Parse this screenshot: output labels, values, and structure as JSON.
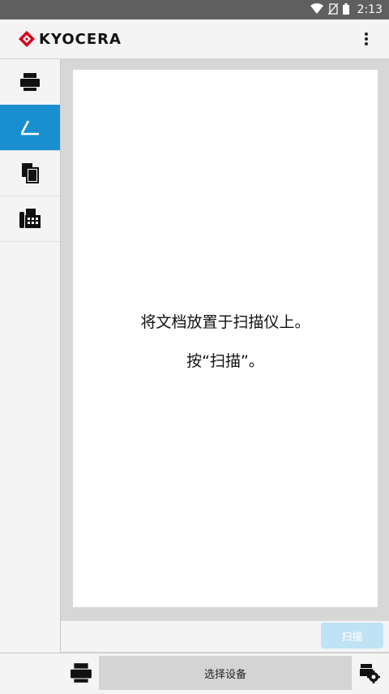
{
  "status_bar": {
    "time": "2:13"
  },
  "app": {
    "brand": "KYOCERA"
  },
  "sidebar": {
    "items": [
      {
        "name": "print",
        "icon": "printer-icon",
        "active": false
      },
      {
        "name": "scan",
        "icon": "scanner-icon",
        "active": true
      },
      {
        "name": "copy",
        "icon": "copy-icon",
        "active": false
      },
      {
        "name": "fax",
        "icon": "fax-icon",
        "active": false
      }
    ]
  },
  "main": {
    "instruction_1": "将文档放置于扫描仪上。",
    "instruction_2": "按“扫描”。"
  },
  "actions": {
    "scan_label": "扫描"
  },
  "bottom": {
    "device_select_label": "选择设备"
  },
  "colors": {
    "accent": "#1a8fd0",
    "scan_button": "#bfe3f4",
    "logo_red": "#d6001c"
  }
}
